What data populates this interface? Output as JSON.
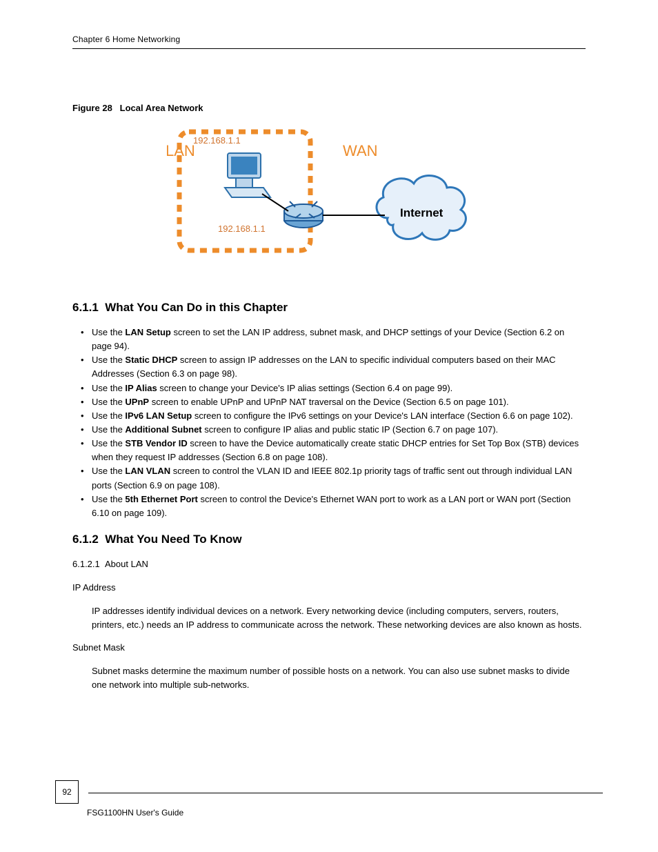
{
  "header": {
    "chapter": "Chapter 6 Home Networking"
  },
  "figure": {
    "number": "Figure 28",
    "title": "Local Area Network",
    "labels": {
      "lan": "LAN",
      "wan": "WAN",
      "ip1": "192.168.1.1",
      "ip2": "192.168.1.1",
      "internet": "Internet"
    }
  },
  "sections": [
    {
      "num": "6.1.1",
      "title": "What You Can Do in this Chapter",
      "bullets": [
        {
          "text": "Use the ",
          "bold": "LAN Setup",
          "tail": " screen to set the LAN IP address, subnet mask, and DHCP settings of your Device (Section 6.2 on page 94)."
        },
        {
          "text": "Use the ",
          "bold": "Static DHCP",
          "tail": " screen to assign IP addresses on the LAN to specific individual computers based on their MAC Addresses (Section 6.3 on page 98)."
        },
        {
          "text": "Use the ",
          "bold": "IP Alias",
          "tail": " screen to change your Device's IP alias settings (Section 6.4 on page 99)."
        },
        {
          "text": "Use the ",
          "bold": "UPnP",
          "tail": " screen to enable UPnP and UPnP NAT traversal on the Device (Section 6.5 on page 101)."
        },
        {
          "text": "Use the ",
          "bold": "IPv6 LAN Setup",
          "tail": " screen to configure the IPv6 settings on your Device's LAN interface (Section 6.6 on page 102)."
        },
        {
          "text": "Use the ",
          "bold": "Additional Subnet",
          "tail": " screen to configure IP alias and public static IP (Section 6.7 on page 107)."
        },
        {
          "text": "Use the ",
          "bold": "STB Vendor ID",
          "tail": " screen to have the Device automatically create static DHCP entries for Set Top Box (STB) devices when they request IP addresses (Section 6.8 on page 108)."
        },
        {
          "text": "Use the ",
          "bold": "LAN VLAN",
          "tail": " screen to control the VLAN ID and IEEE 802.1p priority tags of traffic sent out through individual LAN ports (Section 6.9 on page 108)."
        },
        {
          "text": "Use the ",
          "bold": "5th Ethernet Port",
          "tail": " screen to control the Device's Ethernet WAN port to work as a LAN port or WAN port (Section 6.10 on page 109)."
        }
      ]
    },
    {
      "num": "6.1.2",
      "title": "What You Need To Know",
      "subheads": [
        {
          "h": "6.1.2.1",
          "t": "About LAN"
        }
      ],
      "defs": [
        {
          "term": "IP Address",
          "body": "IP addresses identify individual devices on a network. Every networking device (including computers, servers, routers, printers, etc.) needs an IP address to communicate across the network. These networking devices are also known as hosts."
        },
        {
          "term": "Subnet Mask",
          "body": "Subnet masks determine the maximum number of possible hosts on a network. You can also use subnet masks to divide one network into multiple sub-networks."
        }
      ]
    }
  ],
  "footer": {
    "page": "92",
    "guide": "FSG1100HN User's Guide"
  }
}
